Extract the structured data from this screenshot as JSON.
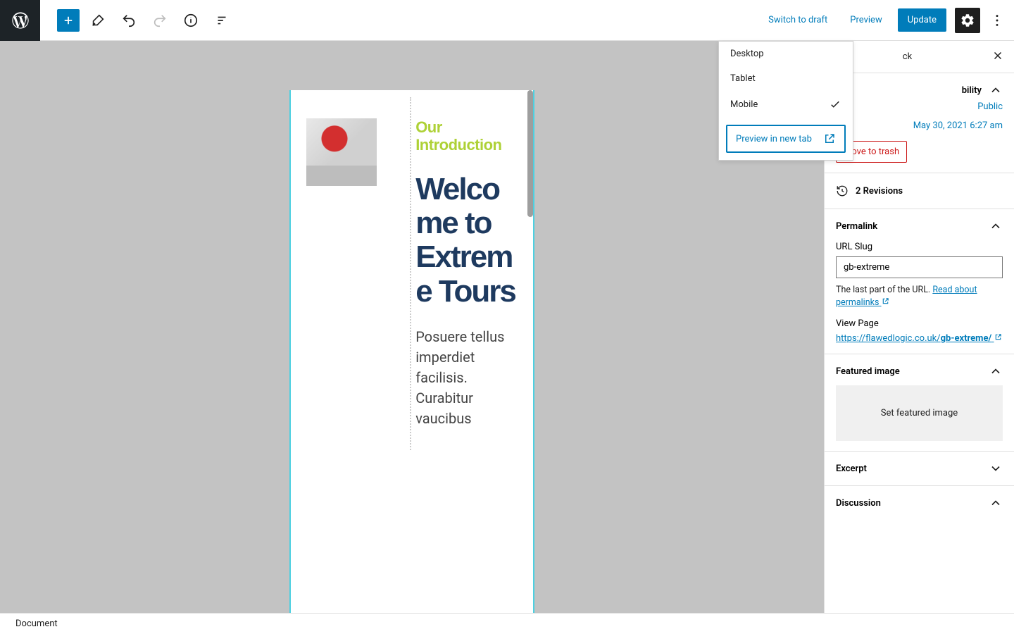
{
  "toolbar": {
    "switch_to_draft": "Switch to draft",
    "preview": "Preview",
    "update": "Update"
  },
  "preview_menu": {
    "desktop": "Desktop",
    "tablet": "Tablet",
    "mobile": "Mobile",
    "new_tab": "Preview in new tab"
  },
  "content": {
    "eyebrow": "Our Introduction",
    "headline": "Welcome to Extreme Tours",
    "body": "Posuere tellus imperdiet facilisis. Curabitur vaucibus"
  },
  "sidebar": {
    "tab_block_partial": "ck",
    "status": {
      "title_partial": "bility",
      "visibility_value": "Public",
      "publish_value": "May 30, 2021 6:27 am",
      "trash": "Move to trash"
    },
    "revisions": "2 Revisions",
    "permalink": {
      "title": "Permalink",
      "slug_label": "URL Slug",
      "slug_value": "gb-extreme",
      "helper_pre": "The last part of the URL. ",
      "helper_link": "Read about permalinks",
      "view_page": "View Page",
      "url_base": "https://flawedlogic.co.uk/",
      "url_slug": "gb-extreme/"
    },
    "featured": {
      "title": "Featured image",
      "set": "Set featured image"
    },
    "excerpt": "Excerpt",
    "discussion": "Discussion"
  },
  "footer": "Document"
}
